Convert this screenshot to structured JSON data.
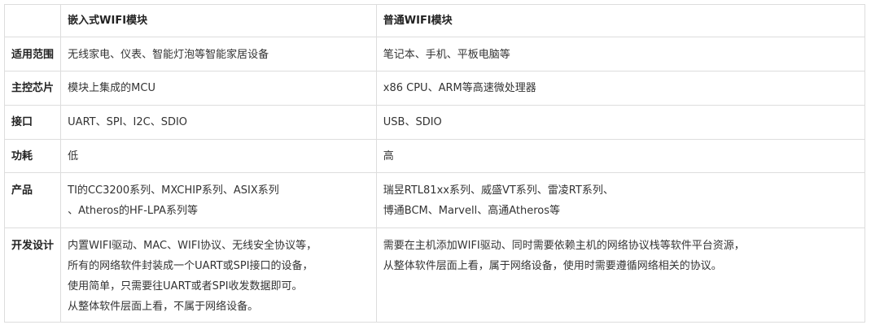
{
  "table": {
    "headers": [
      "",
      "嵌入式WIFI模块",
      "普通WIFI模块"
    ],
    "rows": [
      {
        "label": "适用范围",
        "embedded": [
          "无线家电、仪表、智能灯泡等智能家居设备"
        ],
        "normal": [
          "笔记本、手机、平板电脑等"
        ]
      },
      {
        "label": "主控芯片",
        "embedded": [
          "模块上集成的MCU"
        ],
        "normal": [
          "x86 CPU、ARM等高速微处理器"
        ]
      },
      {
        "label": "接口",
        "embedded": [
          "UART、SPI、I2C、SDIO"
        ],
        "normal": [
          "USB、SDIO"
        ]
      },
      {
        "label": "功耗",
        "embedded": [
          "低"
        ],
        "normal": [
          "高"
        ]
      },
      {
        "label": "产品",
        "embedded": [
          "TI的CC3200系列、MXCHIP系列、ASIX系列",
          "、Atheros的HF-LPA系列等"
        ],
        "normal": [
          "瑞昱RTL81xx系列、威盛VT系列、雷凌RT系列、",
          "博通BCM、Marvell、高通Atheros等"
        ]
      },
      {
        "label": "开发设计",
        "embedded": [
          "内置WIFI驱动、MAC、WIFI协议、无线安全协议等，",
          "所有的网络软件封装成一个UART或SPI接口的设备，",
          "使用简单，只需要往UART或者SPI收发数据即可。",
          "从整体软件层面上看，不属于网络设备。"
        ],
        "normal": [
          "需要在主机添加WIFI驱动、同时需要依赖主机的网络协议栈等软件平台资源，",
          "从整体软件层面上看，属于网络设备，使用时需要遵循网络相关的协议。"
        ]
      }
    ]
  }
}
